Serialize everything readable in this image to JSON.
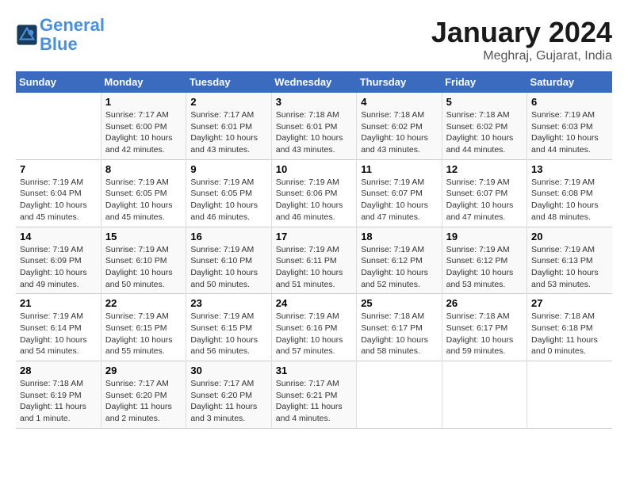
{
  "header": {
    "logo_line1": "General",
    "logo_line2": "Blue",
    "month_year": "January 2024",
    "location": "Meghraj, Gujarat, India"
  },
  "columns": [
    "Sunday",
    "Monday",
    "Tuesday",
    "Wednesday",
    "Thursday",
    "Friday",
    "Saturday"
  ],
  "weeks": [
    [
      {
        "day": "",
        "info": ""
      },
      {
        "day": "1",
        "info": "Sunrise: 7:17 AM\nSunset: 6:00 PM\nDaylight: 10 hours\nand 42 minutes."
      },
      {
        "day": "2",
        "info": "Sunrise: 7:17 AM\nSunset: 6:01 PM\nDaylight: 10 hours\nand 43 minutes."
      },
      {
        "day": "3",
        "info": "Sunrise: 7:18 AM\nSunset: 6:01 PM\nDaylight: 10 hours\nand 43 minutes."
      },
      {
        "day": "4",
        "info": "Sunrise: 7:18 AM\nSunset: 6:02 PM\nDaylight: 10 hours\nand 43 minutes."
      },
      {
        "day": "5",
        "info": "Sunrise: 7:18 AM\nSunset: 6:02 PM\nDaylight: 10 hours\nand 44 minutes."
      },
      {
        "day": "6",
        "info": "Sunrise: 7:19 AM\nSunset: 6:03 PM\nDaylight: 10 hours\nand 44 minutes."
      }
    ],
    [
      {
        "day": "7",
        "info": "Sunrise: 7:19 AM\nSunset: 6:04 PM\nDaylight: 10 hours\nand 45 minutes."
      },
      {
        "day": "8",
        "info": "Sunrise: 7:19 AM\nSunset: 6:05 PM\nDaylight: 10 hours\nand 45 minutes."
      },
      {
        "day": "9",
        "info": "Sunrise: 7:19 AM\nSunset: 6:05 PM\nDaylight: 10 hours\nand 46 minutes."
      },
      {
        "day": "10",
        "info": "Sunrise: 7:19 AM\nSunset: 6:06 PM\nDaylight: 10 hours\nand 46 minutes."
      },
      {
        "day": "11",
        "info": "Sunrise: 7:19 AM\nSunset: 6:07 PM\nDaylight: 10 hours\nand 47 minutes."
      },
      {
        "day": "12",
        "info": "Sunrise: 7:19 AM\nSunset: 6:07 PM\nDaylight: 10 hours\nand 47 minutes."
      },
      {
        "day": "13",
        "info": "Sunrise: 7:19 AM\nSunset: 6:08 PM\nDaylight: 10 hours\nand 48 minutes."
      }
    ],
    [
      {
        "day": "14",
        "info": "Sunrise: 7:19 AM\nSunset: 6:09 PM\nDaylight: 10 hours\nand 49 minutes."
      },
      {
        "day": "15",
        "info": "Sunrise: 7:19 AM\nSunset: 6:10 PM\nDaylight: 10 hours\nand 50 minutes."
      },
      {
        "day": "16",
        "info": "Sunrise: 7:19 AM\nSunset: 6:10 PM\nDaylight: 10 hours\nand 50 minutes."
      },
      {
        "day": "17",
        "info": "Sunrise: 7:19 AM\nSunset: 6:11 PM\nDaylight: 10 hours\nand 51 minutes."
      },
      {
        "day": "18",
        "info": "Sunrise: 7:19 AM\nSunset: 6:12 PM\nDaylight: 10 hours\nand 52 minutes."
      },
      {
        "day": "19",
        "info": "Sunrise: 7:19 AM\nSunset: 6:12 PM\nDaylight: 10 hours\nand 53 minutes."
      },
      {
        "day": "20",
        "info": "Sunrise: 7:19 AM\nSunset: 6:13 PM\nDaylight: 10 hours\nand 53 minutes."
      }
    ],
    [
      {
        "day": "21",
        "info": "Sunrise: 7:19 AM\nSunset: 6:14 PM\nDaylight: 10 hours\nand 54 minutes."
      },
      {
        "day": "22",
        "info": "Sunrise: 7:19 AM\nSunset: 6:15 PM\nDaylight: 10 hours\nand 55 minutes."
      },
      {
        "day": "23",
        "info": "Sunrise: 7:19 AM\nSunset: 6:15 PM\nDaylight: 10 hours\nand 56 minutes."
      },
      {
        "day": "24",
        "info": "Sunrise: 7:19 AM\nSunset: 6:16 PM\nDaylight: 10 hours\nand 57 minutes."
      },
      {
        "day": "25",
        "info": "Sunrise: 7:18 AM\nSunset: 6:17 PM\nDaylight: 10 hours\nand 58 minutes."
      },
      {
        "day": "26",
        "info": "Sunrise: 7:18 AM\nSunset: 6:17 PM\nDaylight: 10 hours\nand 59 minutes."
      },
      {
        "day": "27",
        "info": "Sunrise: 7:18 AM\nSunset: 6:18 PM\nDaylight: 11 hours\nand 0 minutes."
      }
    ],
    [
      {
        "day": "28",
        "info": "Sunrise: 7:18 AM\nSunset: 6:19 PM\nDaylight: 11 hours\nand 1 minute."
      },
      {
        "day": "29",
        "info": "Sunrise: 7:17 AM\nSunset: 6:20 PM\nDaylight: 11 hours\nand 2 minutes."
      },
      {
        "day": "30",
        "info": "Sunrise: 7:17 AM\nSunset: 6:20 PM\nDaylight: 11 hours\nand 3 minutes."
      },
      {
        "day": "31",
        "info": "Sunrise: 7:17 AM\nSunset: 6:21 PM\nDaylight: 11 hours\nand 4 minutes."
      },
      {
        "day": "",
        "info": ""
      },
      {
        "day": "",
        "info": ""
      },
      {
        "day": "",
        "info": ""
      }
    ]
  ]
}
